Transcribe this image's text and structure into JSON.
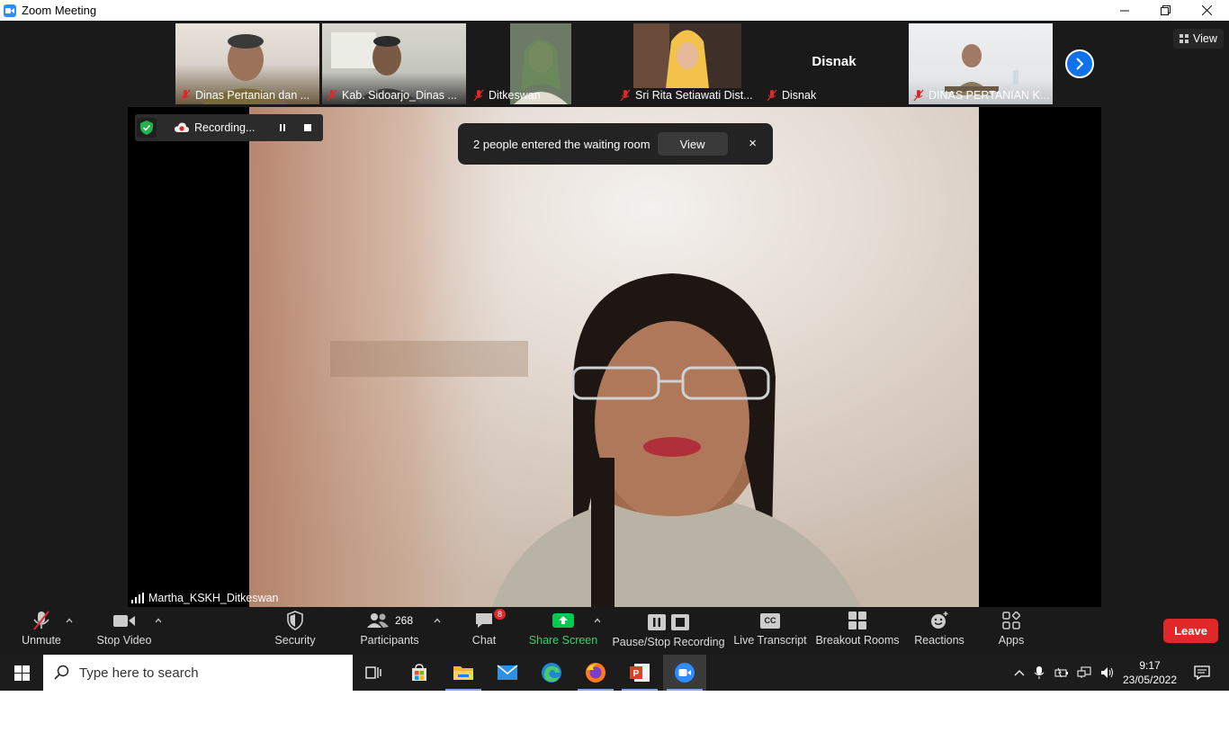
{
  "window": {
    "title": "Zoom Meeting",
    "controls": [
      "minimize",
      "restore",
      "close"
    ]
  },
  "thumbnails": [
    {
      "name": "Dinas Pertanian dan ...",
      "muted": true
    },
    {
      "name": "Kab. Sidoarjo_Dinas ...",
      "muted": true
    },
    {
      "name": "Ditkeswan",
      "muted": true
    },
    {
      "name": "Sri Rita Setiawati Dist...",
      "muted": true
    },
    {
      "name": "Disnak",
      "muted": true,
      "display_name_large": "Disnak"
    },
    {
      "name": "DINAS PERTANIAN K...",
      "muted": true
    }
  ],
  "view_button": {
    "label": "View"
  },
  "recording": {
    "label": "Recording..."
  },
  "notification": {
    "message": "2 people entered the waiting room",
    "action": "View",
    "close": "×"
  },
  "active_speaker": {
    "name": "Martha_KSKH_Ditkeswan"
  },
  "toolbar": {
    "unmute": "Unmute",
    "stop_video": "Stop Video",
    "security": "Security",
    "participants": "Participants",
    "participants_count": "268",
    "chat": "Chat",
    "chat_badge": "8",
    "share_screen": "Share Screen",
    "pause_stop_recording": "Pause/Stop Recording",
    "live_transcript": "Live Transcript",
    "live_transcript_icon_text": "CC",
    "breakout_rooms": "Breakout Rooms",
    "reactions": "Reactions",
    "apps": "Apps",
    "leave": "Leave"
  },
  "taskbar": {
    "search_placeholder": "Type here to search",
    "apps": [
      "task-view-icon",
      "store-icon",
      "file-explorer-icon",
      "mail-icon",
      "edge-icon",
      "firefox-icon",
      "powerpoint-icon",
      "zoom-icon"
    ],
    "time": "9:17",
    "date": "23/05/2022"
  },
  "colors": {
    "zoom_blue": "#0e72ed",
    "leave_red": "#e02828",
    "share_green": "#00c851",
    "meeting_bg": "#1a1a1a"
  }
}
